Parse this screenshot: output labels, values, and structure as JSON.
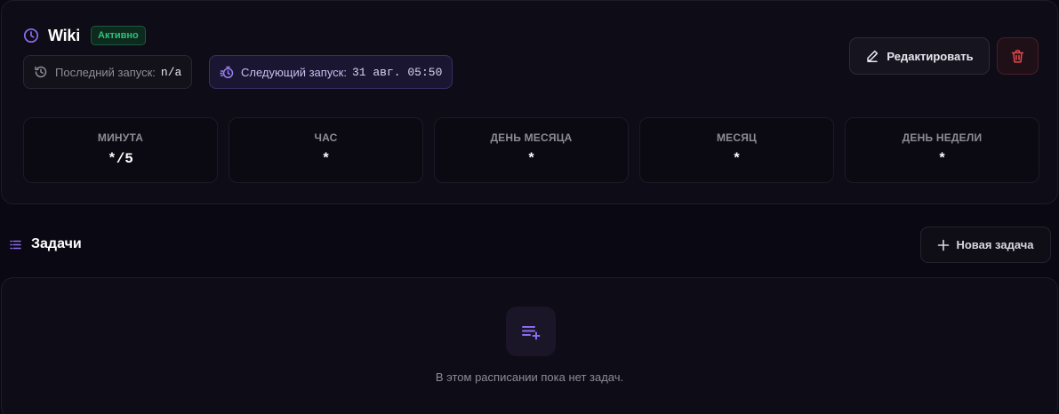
{
  "schedule": {
    "title": "Wiki",
    "status": "Активно",
    "last_run_label": "Последний запуск:",
    "last_run_value": "n/a",
    "next_run_label": "Следующий запуск:",
    "next_run_value": "31 авг. 05:50",
    "edit_label": "Редактировать",
    "icon": "clock-icon"
  },
  "cron": [
    {
      "label": "МИНУТА",
      "value": "*/5"
    },
    {
      "label": "ЧАС",
      "value": "*"
    },
    {
      "label": "ДЕНЬ МЕСЯЦА",
      "value": "*"
    },
    {
      "label": "МЕСЯЦ",
      "value": "*"
    },
    {
      "label": "ДЕНЬ НЕДЕЛИ",
      "value": "*"
    }
  ],
  "tasks": {
    "title": "Задачи",
    "new_task_label": "Новая задача",
    "empty_text": "В этом расписании пока нет задач."
  },
  "colors": {
    "accent": "#8b6cf0",
    "active_green": "#2fc07a",
    "danger": "#e5484d"
  }
}
